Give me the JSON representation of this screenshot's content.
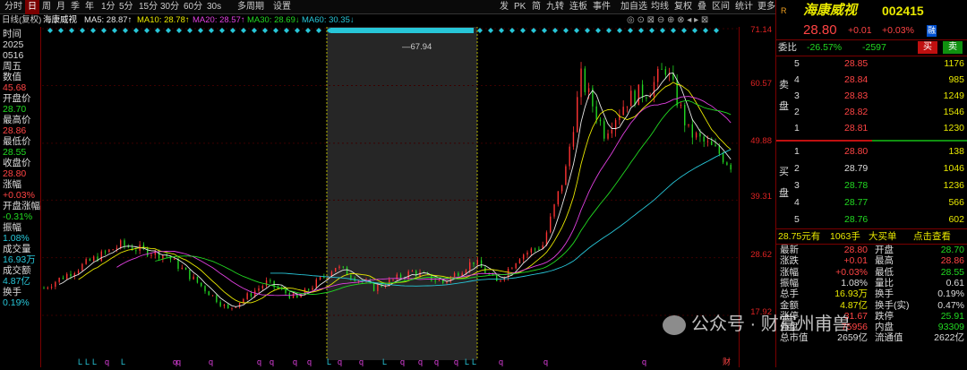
{
  "toolbar": {
    "left": [
      "分时",
      "日",
      "周",
      "月",
      "季",
      "年",
      "1分",
      "5分",
      "15分",
      "30分",
      "60分",
      "30s",
      "多周期",
      "设置"
    ],
    "right": [
      "发",
      "PK",
      "简",
      "九转",
      "连板",
      "事件",
      "加自选",
      "均线",
      "复权",
      "叠",
      "区间",
      "统计",
      "更多"
    ]
  },
  "subbar": {
    "period": "日线(复权)",
    "name": "海康威视",
    "ma5": "MA5: 28.87↑",
    "ma10": "MA10: 28.78↑",
    "ma20": "MA20: 28.57↑",
    "ma30": "MA30: 28.69↓",
    "ma60": "MA60: 30.35↓"
  },
  "left_panel": [
    {
      "label": "时间",
      "value": "2025"
    },
    {
      "label": "",
      "value": "0516"
    },
    {
      "label": "周五",
      "value": ""
    },
    {
      "label": "数值",
      "value": "45.68"
    },
    {
      "label": "开盘价",
      "value": "28.70"
    },
    {
      "label": "最高价",
      "value": "28.86"
    },
    {
      "label": "最低价",
      "value": "28.55"
    },
    {
      "label": "收盘价",
      "value": "28.80"
    },
    {
      "label": "涨幅",
      "value": "+0.03%"
    },
    {
      "label": "开盘涨幅",
      "value": "-0.31%"
    },
    {
      "label": "振幅",
      "value": "1.08%"
    },
    {
      "label": "成交量",
      "value": "16.93万"
    },
    {
      "label": "成交额",
      "value": "4.87亿"
    },
    {
      "label": "换手",
      "value": "0.19%"
    }
  ],
  "y_axis": [
    "71.14",
    "60.57",
    "49.88",
    "39.31",
    "28.62",
    "17.92"
  ],
  "peak_label": "67.94",
  "bottom_markers": [
    "L",
    "L",
    "L",
    "q",
    "L",
    "q",
    "q",
    "q",
    "q",
    "q",
    "q",
    "q",
    "L",
    "q",
    "q",
    "L",
    "q",
    "q",
    "q",
    "q",
    "L",
    "L",
    "q",
    "q",
    "q",
    "财"
  ],
  "quote": {
    "r_label": "R",
    "name": "海康威视",
    "code": "002415",
    "price": "28.80",
    "change": "+0.01",
    "pct": "+0.03%",
    "flag": "融",
    "webi_label": "委比",
    "webi_pct": "-26.57%",
    "webi_num": "-2597",
    "sell_side": "卖盘",
    "buy_side": "买盘",
    "asks": [
      {
        "level": "5",
        "price": "28.85",
        "vol": "1176"
      },
      {
        "level": "4",
        "price": "28.84",
        "vol": "985"
      },
      {
        "level": "3",
        "price": "28.83",
        "vol": "1249"
      },
      {
        "level": "2",
        "price": "28.82",
        "vol": "1546"
      },
      {
        "level": "1",
        "price": "28.81",
        "vol": "1230"
      }
    ],
    "bids": [
      {
        "level": "1",
        "price": "28.80",
        "vol": "138"
      },
      {
        "level": "2",
        "price": "28.79",
        "vol": "1046"
      },
      {
        "level": "3",
        "price": "28.78",
        "vol": "1236"
      },
      {
        "level": "4",
        "price": "28.77",
        "vol": "566"
      },
      {
        "level": "5",
        "price": "28.76",
        "vol": "602"
      }
    ],
    "buy_btn": "买",
    "sell_btn": "卖",
    "big_order_price": "28.75元有",
    "big_order_vol": "1063手",
    "big_order_type": "大买单",
    "big_order_link": "点击查看",
    "stats": [
      {
        "l1": "最新",
        "v1": "28.80",
        "c1": "red",
        "l2": "开盘",
        "v2": "28.70",
        "c2": "green"
      },
      {
        "l1": "涨跌",
        "v1": "+0.01",
        "c1": "red",
        "l2": "最高",
        "v2": "28.86",
        "c2": "red"
      },
      {
        "l1": "涨幅",
        "v1": "+0.03%",
        "c1": "red",
        "l2": "最低",
        "v2": "28.55",
        "c2": "green"
      },
      {
        "l1": "振幅",
        "v1": "1.08%",
        "c1": "white",
        "l2": "量比",
        "v2": "0.61",
        "c2": "white"
      },
      {
        "l1": "总手",
        "v1": "16.93万",
        "c1": "yellow",
        "l2": "换手",
        "v2": "0.19%",
        "c2": "white"
      },
      {
        "l1": "金额",
        "v1": "4.87亿",
        "c1": "yellow",
        "l2": "换手(实)",
        "v2": "0.47%",
        "c2": "white"
      },
      {
        "l1": "涨停",
        "v1": "31.67",
        "c1": "red",
        "l2": "跌停",
        "v2": "25.91",
        "c2": "green"
      },
      {
        "l1": "外盘",
        "v1": "75956",
        "c1": "red",
        "l2": "内盘",
        "v2": "93309",
        "c2": "green"
      },
      {
        "l1": "总市值",
        "v1": "2659亿",
        "c1": "white",
        "l2": "流通值",
        "v2": "2622亿",
        "c2": "white"
      }
    ]
  },
  "watermark": "公众号 · 财富州甫兽",
  "colors": {
    "up": "#ff3333",
    "down": "#21d821",
    "ma5": "#e8e8e8",
    "ma10": "#e8e800",
    "ma20": "#e040e0",
    "ma30": "#21d821",
    "ma60": "#27c6d8",
    "border": "#7a0000"
  }
}
